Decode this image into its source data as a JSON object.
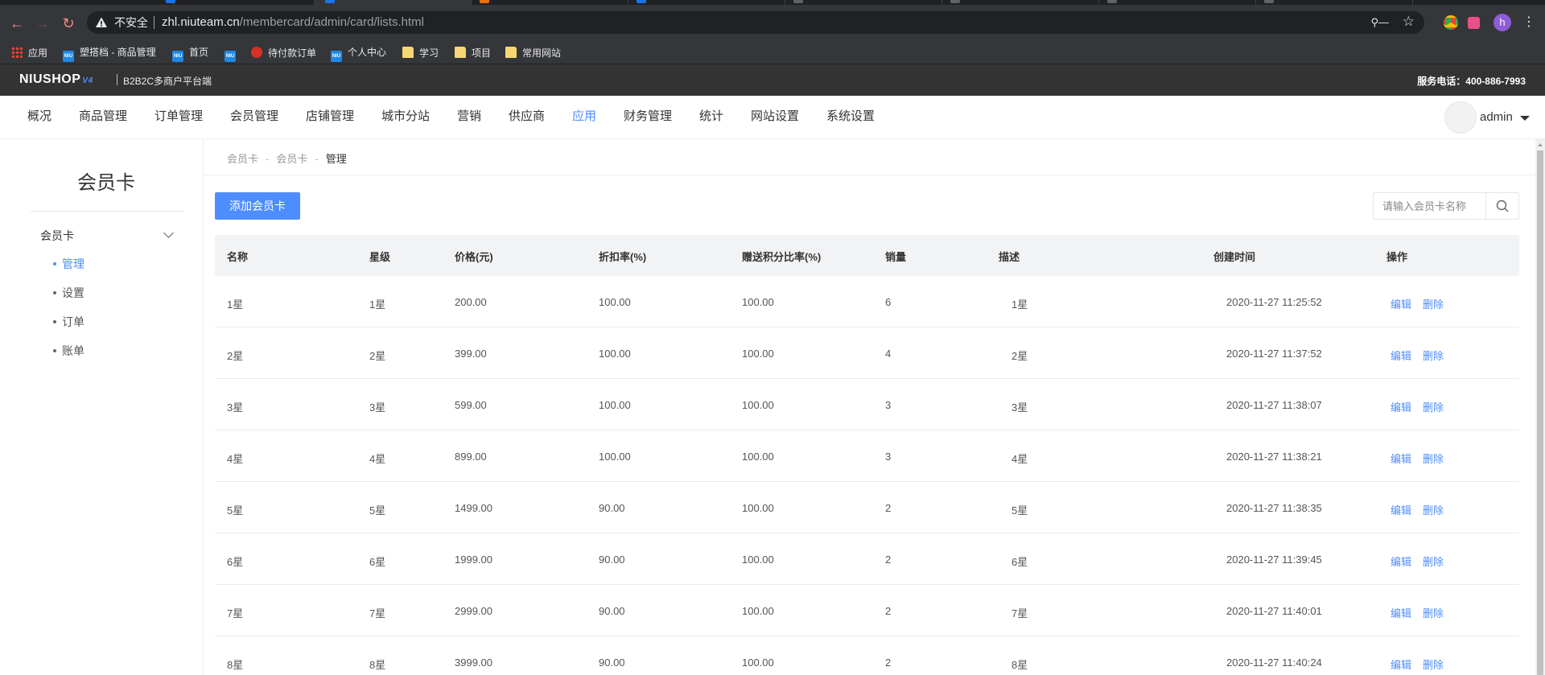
{
  "browser": {
    "insecure_label": "不安全",
    "url_host": "zhl.niuteam.cn",
    "url_path": "/membercard/admin/card/lists.html",
    "profile_letter": "h",
    "tab_widths": [
      [
        0,
        160
      ],
      [
        160,
        160
      ],
      [
        320,
        160
      ],
      [
        480,
        160
      ],
      [
        640,
        160
      ],
      [
        800,
        160
      ],
      [
        960,
        160
      ],
      [
        1120,
        160
      ],
      [
        1280,
        160
      ]
    ]
  },
  "bookmarks": [
    {
      "label": "应用",
      "icon": "apps-icon"
    },
    {
      "label": "塑搭档 - 商品管理",
      "icon": "niu-icon"
    },
    {
      "label": "首页",
      "icon": "niu-icon"
    },
    {
      "label": "",
      "icon": "niu-icon"
    },
    {
      "label": "待付款订单",
      "icon": "red-globe-icon"
    },
    {
      "label": "个人中心",
      "icon": "niu-icon"
    },
    {
      "label": "学习",
      "icon": "folder-icon"
    },
    {
      "label": "项目",
      "icon": "folder-icon"
    },
    {
      "label": "常用网站",
      "icon": "folder-icon"
    }
  ],
  "header": {
    "logo": "NIUSHOP",
    "logo_version": "V4",
    "platform": "B2B2C多商户平台端",
    "phone": "服务电话：400-886-7993"
  },
  "nav": {
    "items": [
      "概况",
      "商品管理",
      "订单管理",
      "会员管理",
      "店铺管理",
      "城市分站",
      "营销",
      "供应商",
      "应用",
      "财务管理",
      "统计",
      "网站设置",
      "系统设置"
    ],
    "active": "应用",
    "user": "admin"
  },
  "sidebar": {
    "title": "会员卡",
    "group": "会员卡",
    "items": [
      "管理",
      "设置",
      "订单",
      "账单"
    ],
    "active": "管理"
  },
  "breadcrumb": [
    "会员卡",
    "会员卡",
    "管理"
  ],
  "toolbar": {
    "add_label": "添加会员卡",
    "search_placeholder": "请输入会员卡名称"
  },
  "table": {
    "columns": [
      "名称",
      "星级",
      "价格(元)",
      "折扣率(%)",
      "赠送积分比率(%)",
      "销量",
      "描述",
      "创建时间",
      "操作"
    ],
    "rows": [
      [
        "1星",
        "1星",
        "200.00",
        "100.00",
        "100.00",
        "6",
        "1星",
        "2020-11-27 11:25:52"
      ],
      [
        "2星",
        "2星",
        "399.00",
        "100.00",
        "100.00",
        "4",
        "2星",
        "2020-11-27 11:37:52"
      ],
      [
        "3星",
        "3星",
        "599.00",
        "100.00",
        "100.00",
        "3",
        "3星",
        "2020-11-27 11:38:07"
      ],
      [
        "4星",
        "4星",
        "899.00",
        "100.00",
        "100.00",
        "3",
        "4星",
        "2020-11-27 11:38:21"
      ],
      [
        "5星",
        "5星",
        "1499.00",
        "90.00",
        "100.00",
        "2",
        "5星",
        "2020-11-27 11:38:35"
      ],
      [
        "6星",
        "6星",
        "1999.00",
        "90.00",
        "100.00",
        "2",
        "6星",
        "2020-11-27 11:39:45"
      ],
      [
        "7星",
        "7星",
        "2999.00",
        "90.00",
        "100.00",
        "2",
        "7星",
        "2020-11-27 11:40:01"
      ],
      [
        "8星",
        "8星",
        "3999.00",
        "90.00",
        "100.00",
        "2",
        "8星",
        "2020-11-27 11:40:24"
      ]
    ],
    "edit_label": "编辑",
    "delete_label": "删除"
  },
  "colors": {
    "accent": "#4d8dff",
    "admin_bar": "#333333",
    "browser_dark": "#202124"
  }
}
